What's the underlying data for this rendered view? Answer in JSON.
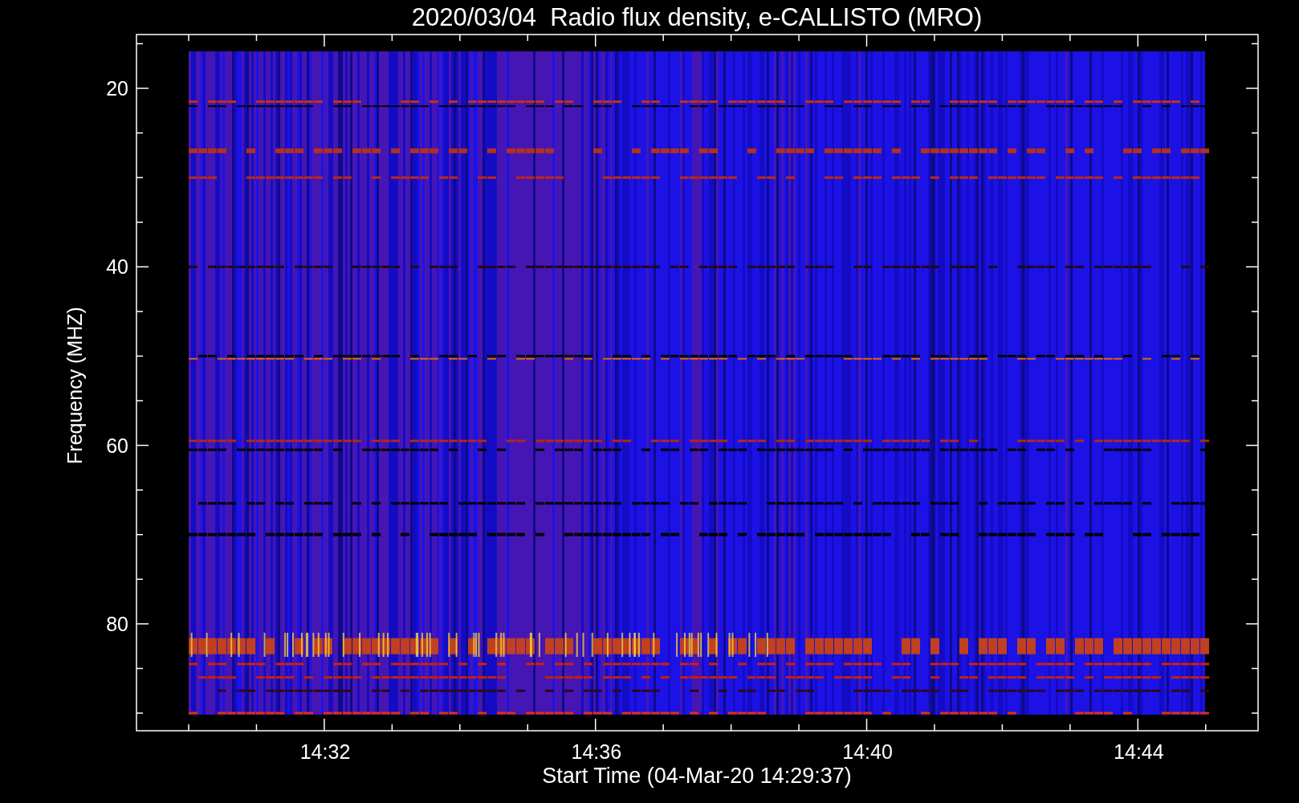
{
  "title": "2020/03/04  Radio flux density, e-CALLISTO (MRO)",
  "y_axis": {
    "label": "Frequency (MHZ)",
    "ticks": [
      "20",
      "40",
      "60",
      "80"
    ]
  },
  "x_axis": {
    "label": "Start Time (04-Mar-20 14:29:37)",
    "ticks": [
      "14:32",
      "14:36",
      "14:40",
      "14:44"
    ]
  }
}
